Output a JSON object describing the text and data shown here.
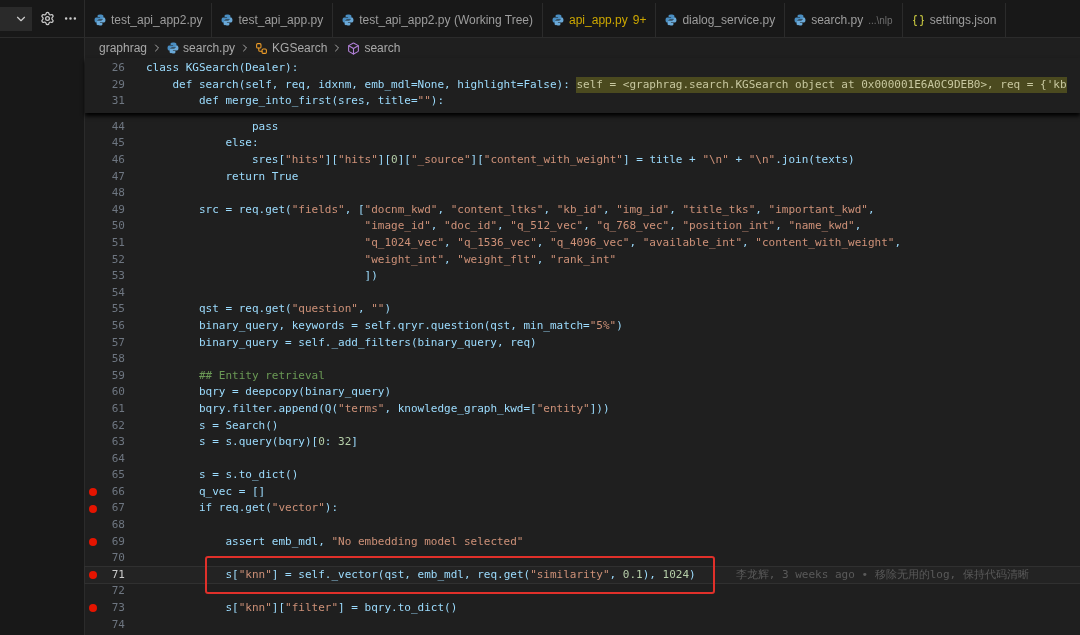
{
  "tabs": [
    {
      "label": "test_api_app2.py",
      "kind": "python",
      "selected": false,
      "warning": false
    },
    {
      "label": "test_api_app.py",
      "kind": "python",
      "selected": false,
      "warning": false
    },
    {
      "label": "test_api_app2.py (Working Tree)",
      "kind": "python",
      "selected": false,
      "warning": false
    },
    {
      "label": "api_app.py",
      "kind": "python",
      "selected": false,
      "warning": true,
      "badge": "9+"
    },
    {
      "label": "dialog_service.py",
      "kind": "python",
      "selected": false,
      "warning": false
    },
    {
      "label": "search.py",
      "kind": "python",
      "selected": false,
      "warning": false,
      "description": "...\\nlp"
    },
    {
      "label": "settings.json",
      "kind": "json",
      "selected": false,
      "warning": false
    }
  ],
  "breadcrumb": [
    {
      "label": "graphrag",
      "kind": "folder"
    },
    {
      "label": "search.py",
      "kind": "python"
    },
    {
      "label": "KGSearch",
      "kind": "class"
    },
    {
      "label": "search",
      "kind": "method"
    }
  ],
  "sticky_lines": [
    {
      "number": "26",
      "text": "class KGSearch(Dealer):"
    },
    {
      "number": "29",
      "text": "    def search(self, req, idxnm, emb_mdl=None, highlight=False): ",
      "inline_value": "self = <graphrag.search.KGSearch object at 0x000001E6A0C9DEB0>, req = {'kb"
    },
    {
      "number": "31",
      "text": "        def merge_into_first(sres, title=\"\"):"
    }
  ],
  "lines": [
    {
      "number": "44",
      "text": "                pass",
      "breakpoint": false,
      "current": false,
      "boxed": false
    },
    {
      "number": "45",
      "text": "            else:",
      "breakpoint": false,
      "current": false,
      "boxed": false
    },
    {
      "number": "46",
      "text": "                sres[\"hits\"][\"hits\"][0][\"_source\"][\"content_with_weight\"] = title + \"\\n\" + \"\\n\".join(texts)",
      "breakpoint": false,
      "current": false,
      "boxed": false
    },
    {
      "number": "47",
      "text": "            return True",
      "breakpoint": false,
      "current": false,
      "boxed": false
    },
    {
      "number": "48",
      "breakpoint": false,
      "current": false,
      "boxed": false
    },
    {
      "number": "49",
      "text": "        src = req.get(\"fields\", [\"docnm_kwd\", \"content_ltks\", \"kb_id\", \"img_id\", \"title_tks\", \"important_kwd\",",
      "breakpoint": false,
      "current": false,
      "boxed": false
    },
    {
      "number": "50",
      "text": "                                 \"image_id\", \"doc_id\", \"q_512_vec\", \"q_768_vec\", \"position_int\", \"name_kwd\",",
      "breakpoint": false,
      "current": false,
      "boxed": false
    },
    {
      "number": "51",
      "text": "                                 \"q_1024_vec\", \"q_1536_vec\", \"q_4096_vec\", \"available_int\", \"content_with_weight\",",
      "breakpoint": false,
      "current": false,
      "boxed": false
    },
    {
      "number": "52",
      "text": "                                 \"weight_int\", \"weight_flt\", \"rank_int\"",
      "breakpoint": false,
      "current": false,
      "boxed": false
    },
    {
      "number": "53",
      "text": "                                 ])",
      "breakpoint": false,
      "current": false,
      "boxed": false
    },
    {
      "number": "54",
      "breakpoint": false,
      "current": false,
      "boxed": false
    },
    {
      "number": "55",
      "text": "        qst = req.get(\"question\", \"\")",
      "breakpoint": false,
      "current": false,
      "boxed": false
    },
    {
      "number": "56",
      "text": "        binary_query, keywords = self.qryr.question(qst, min_match=\"5%\")",
      "breakpoint": false,
      "current": false,
      "boxed": false
    },
    {
      "number": "57",
      "text": "        binary_query = self._add_filters(binary_query, req)",
      "breakpoint": false,
      "current": false,
      "boxed": false
    },
    {
      "number": "58",
      "breakpoint": false,
      "current": false,
      "boxed": false
    },
    {
      "number": "59",
      "text": "        ## Entity retrieval",
      "breakpoint": false,
      "current": false,
      "boxed": false
    },
    {
      "number": "60",
      "text": "        bqry = deepcopy(binary_query)",
      "breakpoint": false,
      "current": false,
      "boxed": false
    },
    {
      "number": "61",
      "text": "        bqry.filter.append(Q(\"terms\", knowledge_graph_kwd=[\"entity\"]))",
      "breakpoint": false,
      "current": false,
      "boxed": false
    },
    {
      "number": "62",
      "text": "        s = Search()",
      "breakpoint": false,
      "current": false,
      "boxed": false
    },
    {
      "number": "63",
      "text": "        s = s.query(bqry)[0: 32]",
      "breakpoint": false,
      "current": false,
      "boxed": false
    },
    {
      "number": "64",
      "breakpoint": false,
      "current": false,
      "boxed": false
    },
    {
      "number": "65",
      "text": "        s = s.to_dict()",
      "breakpoint": false,
      "current": false,
      "boxed": false
    },
    {
      "number": "66",
      "text": "        q_vec = []",
      "breakpoint": true,
      "current": false,
      "boxed": false
    },
    {
      "number": "67",
      "text": "        if req.get(\"vector\"):",
      "breakpoint": true,
      "current": false,
      "boxed": false
    },
    {
      "number": "68",
      "breakpoint": false,
      "current": false,
      "boxed": false
    },
    {
      "number": "69",
      "text": "            assert emb_mdl, \"No embedding model selected\"",
      "breakpoint": true,
      "current": false,
      "boxed": false
    },
    {
      "number": "70",
      "breakpoint": false,
      "current": false,
      "boxed": false
    },
    {
      "number": "71",
      "text": "            s[\"knn\"] = self._vector(qst, emb_mdl, req.get(\"similarity\", 0.1), 1024)",
      "breakpoint": true,
      "current": true,
      "boxed": true,
      "blame": "李龙辉, 3 weeks ago • 移除无用的log, 保持代码清晰"
    },
    {
      "number": "72",
      "breakpoint": false,
      "current": false,
      "boxed": false
    },
    {
      "number": "73",
      "text": "            s[\"knn\"][\"filter\"] = bqry.to_dict()",
      "breakpoint": true,
      "current": false,
      "boxed": false
    },
    {
      "number": "74",
      "breakpoint": false,
      "current": false,
      "boxed": false
    }
  ]
}
